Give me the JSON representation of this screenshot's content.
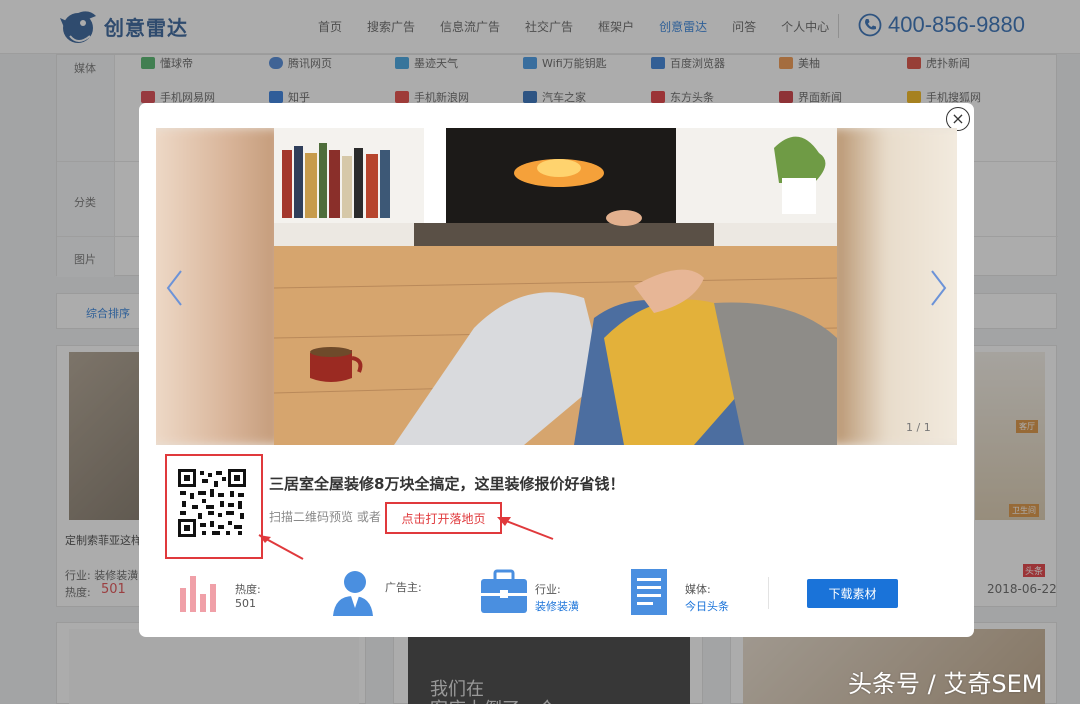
{
  "header": {
    "brand": "创意雷达",
    "nav": [
      "首页",
      "搜索广告",
      "信息流广告",
      "社交广告",
      "框架户",
      "创意雷达",
      "问答",
      "个人中心"
    ],
    "active_index": 5,
    "phone": "400-856-9880"
  },
  "filters": {
    "media_label": "媒体",
    "category_label": "分类",
    "image_label": "图片",
    "media_row1": [
      "懂球帝",
      "腾讯网页",
      "墨迹天气",
      "Wifi万能钥匙",
      "百度浏览器",
      "美柚",
      "虎扑新闻"
    ],
    "media_row2": [
      "手机网易网",
      "知乎",
      "手机新浪网",
      "汽车之家",
      "东方头条",
      "界面新闻",
      "手机搜狐网"
    ],
    "sort_label": "综合排序"
  },
  "background_cards": {
    "left_title": "定制索菲亚这样",
    "left_industry": "行业: 装修装潢",
    "left_heat_label": "热度:",
    "left_heat_value": "501",
    "right_badge": "头条",
    "right_date": "2018-06-22",
    "right_tag_top": "客厅",
    "right_tag_bottom": "卫生间",
    "bottom_mid_text": "我们在",
    "bottom_mid_text2": "客店上倒了一个"
  },
  "modal": {
    "close_symbol": "×",
    "counter": "1 / 1",
    "title": "三居室全屋装修8万块全搞定，这里装修报价好省钱！",
    "scan_text": "扫描二维码预览 或者",
    "landing_link": "点击打开落地页",
    "heat_label": "热度:",
    "heat_value": "501",
    "advertiser_label": "广告主:",
    "advertiser_value": "",
    "industry_label": "行业:",
    "industry_value": "装修装潢",
    "media_label": "媒体:",
    "media_value": "今日头条",
    "download_button": "下载素材"
  },
  "watermark": "头条号 / 艾奇SEM",
  "colors": {
    "brand_blue": "#1d4f8f",
    "link_blue": "#1a73d9",
    "annotation_red": "#e0393c",
    "heat_bar_pink": "#f0a0a8"
  },
  "icons": {
    "heat": "bar-chart-icon",
    "advertiser": "person-icon",
    "industry": "briefcase-icon",
    "media": "document-icon",
    "phone": "phone-icon"
  }
}
